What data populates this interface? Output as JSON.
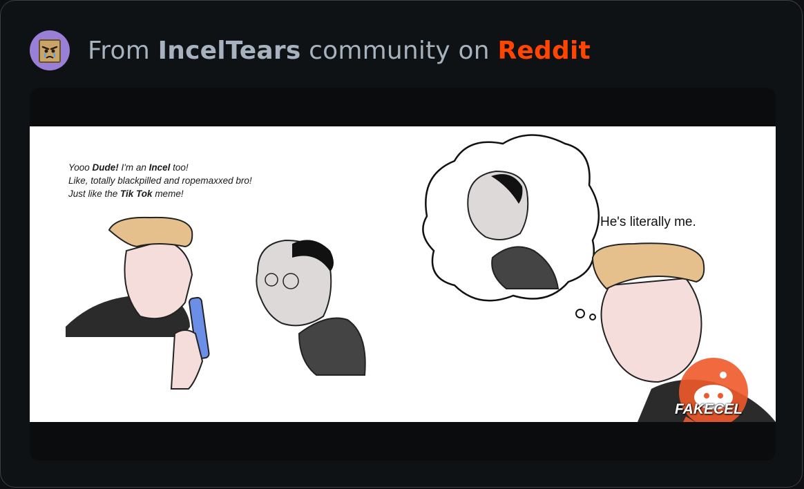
{
  "header": {
    "prefix": "From",
    "community": "IncelTears",
    "middle": "community on",
    "platform": "Reddit",
    "avatar_icon": "crying-bag-face-avatar-icon"
  },
  "comic": {
    "left_caption": {
      "line1_a": "Yooo ",
      "line1_b": "Dude!",
      "line1_c": " I'm an ",
      "line1_d": "Incel",
      "line1_e": " too!",
      "line2": "Like, totally blackpilled and ropemaxxed bro!",
      "line3_a": "Just like the ",
      "line3_b": "Tik Tok",
      "line3_c": " meme!"
    },
    "right_caption": "He's literally me.",
    "watermark": "FAKECEL"
  },
  "colors": {
    "reddit_orange": "#ff4500",
    "avatar_bg": "#9a7fd6",
    "card_bg": "#0f1215"
  }
}
